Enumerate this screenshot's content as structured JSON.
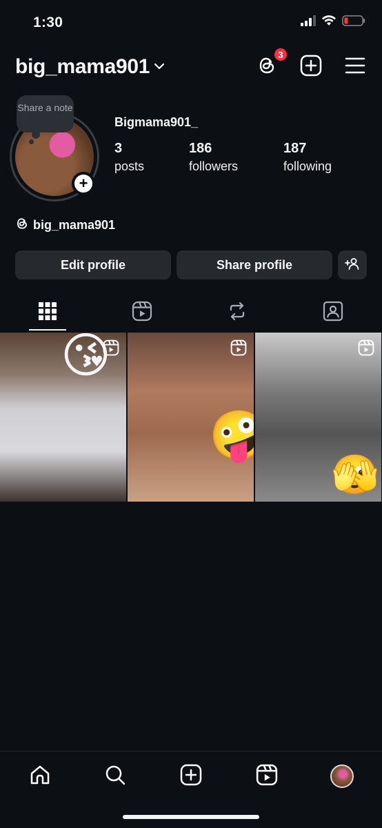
{
  "status_bar": {
    "time": "1:30"
  },
  "header": {
    "username": "big_mama901",
    "threads_badge_count": "3"
  },
  "profile": {
    "note_placeholder": "Share a note",
    "display_name": "Bigmama901_",
    "stats": [
      {
        "value": "3",
        "label": "posts"
      },
      {
        "value": "186",
        "label": "followers"
      },
      {
        "value": "187",
        "label": "following"
      }
    ],
    "threads_handle": "big_mama901"
  },
  "buttons": {
    "edit_profile": "Edit profile",
    "share_profile": "Share profile"
  },
  "tabs": [
    {
      "icon": "grid-icon",
      "active": true
    },
    {
      "icon": "reels-icon",
      "active": false
    },
    {
      "icon": "reposts-icon",
      "active": false
    },
    {
      "icon": "tagged-icon",
      "active": false
    }
  ],
  "posts": [
    {
      "type": "reel",
      "emoji": "😘"
    },
    {
      "type": "reel",
      "emoji": "🤪"
    },
    {
      "type": "reel",
      "emoji": "🫣"
    }
  ],
  "bottom_nav": [
    "home-icon",
    "search-icon",
    "create-icon",
    "reels-icon",
    "profile-avatar"
  ],
  "colors": {
    "background": "#0c1014",
    "button_bg": "#262a2f",
    "badge": "#ff3040",
    "battery_low": "#ff3b30"
  }
}
